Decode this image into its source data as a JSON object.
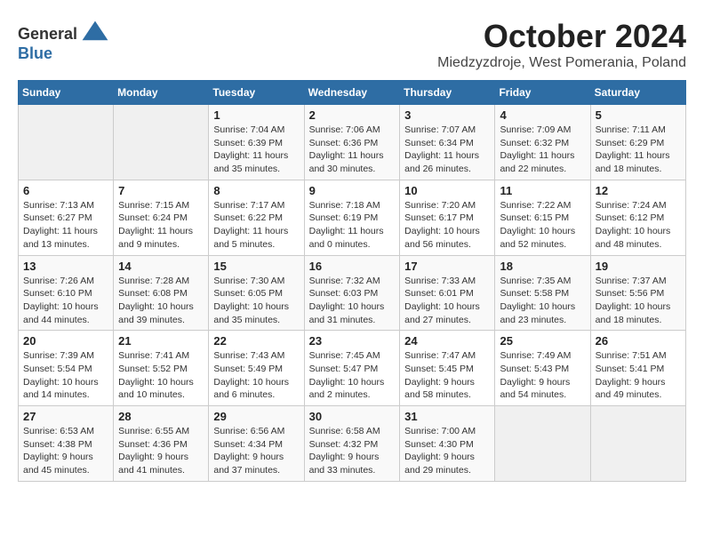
{
  "header": {
    "logo_general": "General",
    "logo_blue": "Blue",
    "month": "October 2024",
    "location": "Miedzyzdroje, West Pomerania, Poland"
  },
  "days_of_week": [
    "Sunday",
    "Monday",
    "Tuesday",
    "Wednesday",
    "Thursday",
    "Friday",
    "Saturday"
  ],
  "weeks": [
    [
      {
        "day": null
      },
      {
        "day": null
      },
      {
        "day": "1",
        "sunrise": "Sunrise: 7:04 AM",
        "sunset": "Sunset: 6:39 PM",
        "daylight": "Daylight: 11 hours and 35 minutes."
      },
      {
        "day": "2",
        "sunrise": "Sunrise: 7:06 AM",
        "sunset": "Sunset: 6:36 PM",
        "daylight": "Daylight: 11 hours and 30 minutes."
      },
      {
        "day": "3",
        "sunrise": "Sunrise: 7:07 AM",
        "sunset": "Sunset: 6:34 PM",
        "daylight": "Daylight: 11 hours and 26 minutes."
      },
      {
        "day": "4",
        "sunrise": "Sunrise: 7:09 AM",
        "sunset": "Sunset: 6:32 PM",
        "daylight": "Daylight: 11 hours and 22 minutes."
      },
      {
        "day": "5",
        "sunrise": "Sunrise: 7:11 AM",
        "sunset": "Sunset: 6:29 PM",
        "daylight": "Daylight: 11 hours and 18 minutes."
      }
    ],
    [
      {
        "day": "6",
        "sunrise": "Sunrise: 7:13 AM",
        "sunset": "Sunset: 6:27 PM",
        "daylight": "Daylight: 11 hours and 13 minutes."
      },
      {
        "day": "7",
        "sunrise": "Sunrise: 7:15 AM",
        "sunset": "Sunset: 6:24 PM",
        "daylight": "Daylight: 11 hours and 9 minutes."
      },
      {
        "day": "8",
        "sunrise": "Sunrise: 7:17 AM",
        "sunset": "Sunset: 6:22 PM",
        "daylight": "Daylight: 11 hours and 5 minutes."
      },
      {
        "day": "9",
        "sunrise": "Sunrise: 7:18 AM",
        "sunset": "Sunset: 6:19 PM",
        "daylight": "Daylight: 11 hours and 0 minutes."
      },
      {
        "day": "10",
        "sunrise": "Sunrise: 7:20 AM",
        "sunset": "Sunset: 6:17 PM",
        "daylight": "Daylight: 10 hours and 56 minutes."
      },
      {
        "day": "11",
        "sunrise": "Sunrise: 7:22 AM",
        "sunset": "Sunset: 6:15 PM",
        "daylight": "Daylight: 10 hours and 52 minutes."
      },
      {
        "day": "12",
        "sunrise": "Sunrise: 7:24 AM",
        "sunset": "Sunset: 6:12 PM",
        "daylight": "Daylight: 10 hours and 48 minutes."
      }
    ],
    [
      {
        "day": "13",
        "sunrise": "Sunrise: 7:26 AM",
        "sunset": "Sunset: 6:10 PM",
        "daylight": "Daylight: 10 hours and 44 minutes."
      },
      {
        "day": "14",
        "sunrise": "Sunrise: 7:28 AM",
        "sunset": "Sunset: 6:08 PM",
        "daylight": "Daylight: 10 hours and 39 minutes."
      },
      {
        "day": "15",
        "sunrise": "Sunrise: 7:30 AM",
        "sunset": "Sunset: 6:05 PM",
        "daylight": "Daylight: 10 hours and 35 minutes."
      },
      {
        "day": "16",
        "sunrise": "Sunrise: 7:32 AM",
        "sunset": "Sunset: 6:03 PM",
        "daylight": "Daylight: 10 hours and 31 minutes."
      },
      {
        "day": "17",
        "sunrise": "Sunrise: 7:33 AM",
        "sunset": "Sunset: 6:01 PM",
        "daylight": "Daylight: 10 hours and 27 minutes."
      },
      {
        "day": "18",
        "sunrise": "Sunrise: 7:35 AM",
        "sunset": "Sunset: 5:58 PM",
        "daylight": "Daylight: 10 hours and 23 minutes."
      },
      {
        "day": "19",
        "sunrise": "Sunrise: 7:37 AM",
        "sunset": "Sunset: 5:56 PM",
        "daylight": "Daylight: 10 hours and 18 minutes."
      }
    ],
    [
      {
        "day": "20",
        "sunrise": "Sunrise: 7:39 AM",
        "sunset": "Sunset: 5:54 PM",
        "daylight": "Daylight: 10 hours and 14 minutes."
      },
      {
        "day": "21",
        "sunrise": "Sunrise: 7:41 AM",
        "sunset": "Sunset: 5:52 PM",
        "daylight": "Daylight: 10 hours and 10 minutes."
      },
      {
        "day": "22",
        "sunrise": "Sunrise: 7:43 AM",
        "sunset": "Sunset: 5:49 PM",
        "daylight": "Daylight: 10 hours and 6 minutes."
      },
      {
        "day": "23",
        "sunrise": "Sunrise: 7:45 AM",
        "sunset": "Sunset: 5:47 PM",
        "daylight": "Daylight: 10 hours and 2 minutes."
      },
      {
        "day": "24",
        "sunrise": "Sunrise: 7:47 AM",
        "sunset": "Sunset: 5:45 PM",
        "daylight": "Daylight: 9 hours and 58 minutes."
      },
      {
        "day": "25",
        "sunrise": "Sunrise: 7:49 AM",
        "sunset": "Sunset: 5:43 PM",
        "daylight": "Daylight: 9 hours and 54 minutes."
      },
      {
        "day": "26",
        "sunrise": "Sunrise: 7:51 AM",
        "sunset": "Sunset: 5:41 PM",
        "daylight": "Daylight: 9 hours and 49 minutes."
      }
    ],
    [
      {
        "day": "27",
        "sunrise": "Sunrise: 6:53 AM",
        "sunset": "Sunset: 4:38 PM",
        "daylight": "Daylight: 9 hours and 45 minutes."
      },
      {
        "day": "28",
        "sunrise": "Sunrise: 6:55 AM",
        "sunset": "Sunset: 4:36 PM",
        "daylight": "Daylight: 9 hours and 41 minutes."
      },
      {
        "day": "29",
        "sunrise": "Sunrise: 6:56 AM",
        "sunset": "Sunset: 4:34 PM",
        "daylight": "Daylight: 9 hours and 37 minutes."
      },
      {
        "day": "30",
        "sunrise": "Sunrise: 6:58 AM",
        "sunset": "Sunset: 4:32 PM",
        "daylight": "Daylight: 9 hours and 33 minutes."
      },
      {
        "day": "31",
        "sunrise": "Sunrise: 7:00 AM",
        "sunset": "Sunset: 4:30 PM",
        "daylight": "Daylight: 9 hours and 29 minutes."
      },
      {
        "day": null
      },
      {
        "day": null
      }
    ]
  ]
}
